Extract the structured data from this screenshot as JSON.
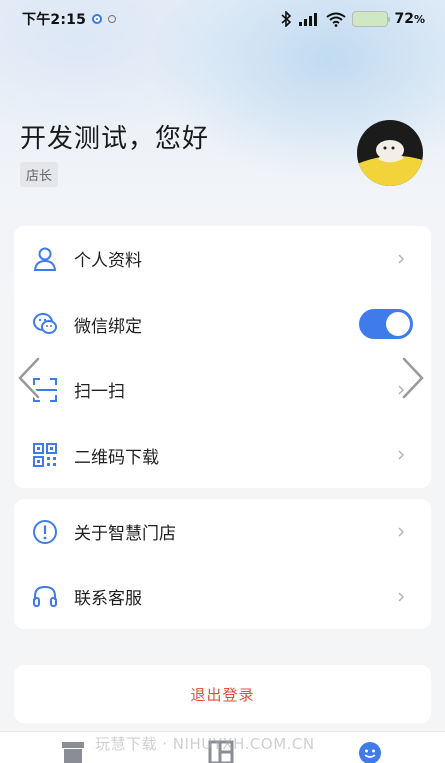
{
  "status_bar": {
    "time": "下午2:15",
    "battery_pct": "72",
    "battery_unit": "%"
  },
  "profile": {
    "greeting": "开发测试，您好",
    "role": "店长"
  },
  "menu_group_1": [
    {
      "label": "个人资料",
      "icon": "user-icon"
    },
    {
      "label": "微信绑定",
      "icon": "wechat-icon",
      "toggle_on": true
    },
    {
      "label": "扫一扫",
      "icon": "scan-icon"
    },
    {
      "label": "二维码下载",
      "icon": "qrcode-icon"
    }
  ],
  "menu_group_2": [
    {
      "label": "关于智慧门店",
      "icon": "info-icon"
    },
    {
      "label": "联系客服",
      "icon": "headset-icon"
    }
  ],
  "logout_label": "退出登录",
  "watermark": "玩慧下载 · NIHUYXH.COM.CN",
  "colors": {
    "accent": "#3f7bea",
    "danger": "#e0503f"
  }
}
